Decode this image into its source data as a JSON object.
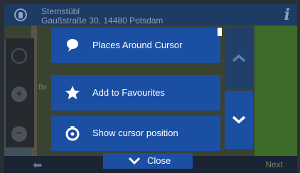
{
  "location": {
    "name": "Sternstübl",
    "address": "Gaußstraße 30, 14480 Potsdam",
    "info_label": "i"
  },
  "map": {
    "street_fragment": "Be"
  },
  "context_menu": {
    "items": [
      {
        "label": "Places Around Cursor",
        "icon": "speech-bubble-icon"
      },
      {
        "label": "Add to Favourites",
        "icon": "star-icon"
      },
      {
        "label": "Show cursor position",
        "icon": "cursor-position-icon"
      }
    ],
    "close_label": "Close"
  },
  "bottom_bar": {
    "next_label": "Next"
  },
  "colors": {
    "menu_blue": "#1b4fa3",
    "header_blue": "#1d3b63",
    "text_white": "#ffffff"
  }
}
